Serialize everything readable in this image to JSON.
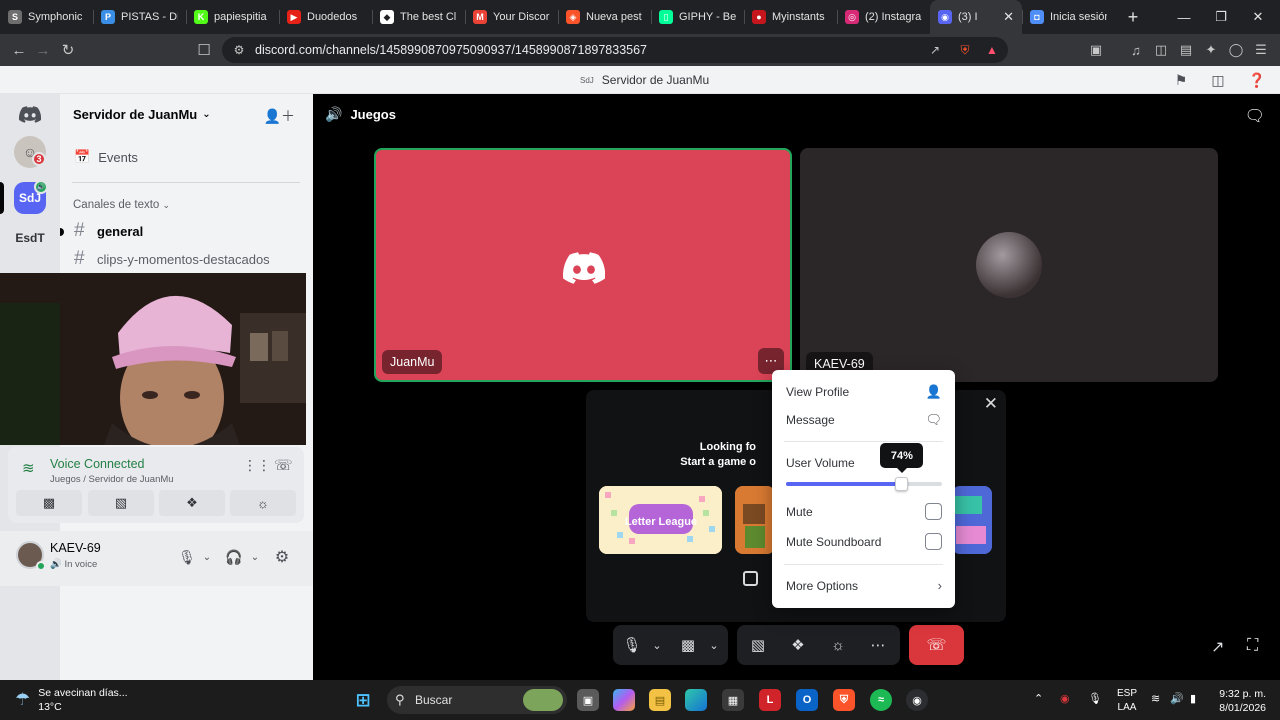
{
  "browser": {
    "tabs": [
      {
        "label": "Symphonic",
        "color": "#6e6e6e",
        "glyph": "S"
      },
      {
        "label": "PISTAS - DE",
        "color": "#3a8ee6",
        "glyph": "P"
      },
      {
        "label": "papiespitia",
        "color": "#53fc18",
        "glyph": "K"
      },
      {
        "label": "Duodedos",
        "color": "#e62117",
        "glyph": "▶"
      },
      {
        "label": "The best Cl",
        "color": "#ffffff",
        "glyph": "◆"
      },
      {
        "label": "Your Discor",
        "color": "#ea4335",
        "glyph": "M"
      },
      {
        "label": "Nueva pest",
        "color": "#fb542b",
        "glyph": "◈"
      },
      {
        "label": "GIPHY - Be",
        "color": "#00ff99",
        "glyph": "▯"
      },
      {
        "label": "Myinstants",
        "color": "#c4161c",
        "glyph": "●"
      },
      {
        "label": "(2) Instagra",
        "color": "#d62976",
        "glyph": "◎"
      },
      {
        "label": "(3) I",
        "color": "#5865f2",
        "glyph": "◉",
        "active": true
      },
      {
        "label": "Inicia sesión",
        "color": "#4f8ef7",
        "glyph": "◘"
      }
    ],
    "new_tab": "+",
    "url": "discord.com/channels/1458990870975090937/1458990871897833567"
  },
  "discord_titlebar": {
    "server_short": "SdJ",
    "server_name": "Servidor de JuanMu"
  },
  "rail": [
    {
      "name": "discord-home",
      "label": "",
      "bg": "#e3e5e8"
    },
    {
      "name": "avatar-server",
      "label": "",
      "badge": "3",
      "bg": "#c9c4be"
    },
    {
      "name": "sdj-server",
      "label": "SdJ",
      "bg": "#5865f2"
    },
    {
      "name": "esdt-server",
      "label": "EsdT",
      "bg": "#e3e5e8"
    }
  ],
  "sidebar": {
    "server_name": "Servidor de JuanMu",
    "events_label": "Events",
    "category": "Canales de texto",
    "channels": [
      {
        "name": "general",
        "unread": true
      },
      {
        "name": "clips-y-momentos-destacados",
        "unread": false
      }
    ]
  },
  "voice": {
    "status": "Voice Connected",
    "location": "Juegos / Servidor de JuanMu"
  },
  "user": {
    "name": "KAEV-69",
    "status": "In voice"
  },
  "stage": {
    "channel_name": "Juegos",
    "tiles": [
      {
        "name": "JuanMu"
      },
      {
        "name": "KAEV-69"
      }
    ],
    "activity": {
      "title_line1": "Looking fo",
      "title_line2": "Start a game o",
      "card_label": "Letter League"
    }
  },
  "context_menu": {
    "view_profile": "View Profile",
    "message": "Message",
    "user_volume_label": "User Volume",
    "user_volume_percent": 74,
    "user_volume_display": "74%",
    "mute": "Mute",
    "mute_soundboard": "Mute Soundboard",
    "more_options": "More Options"
  },
  "taskbar": {
    "weather_line1": "Se avecinan días...",
    "weather_line2": "13°C",
    "search_placeholder": "Buscar",
    "lang_line1": "ESP",
    "lang_line2": "LAA",
    "time": "9:32 p. m.",
    "date": "8/01/2026"
  },
  "colors": {
    "brand": "#5865f2",
    "danger": "#da373c",
    "connected": "#23a55a",
    "tile_bg": "#db4356"
  }
}
